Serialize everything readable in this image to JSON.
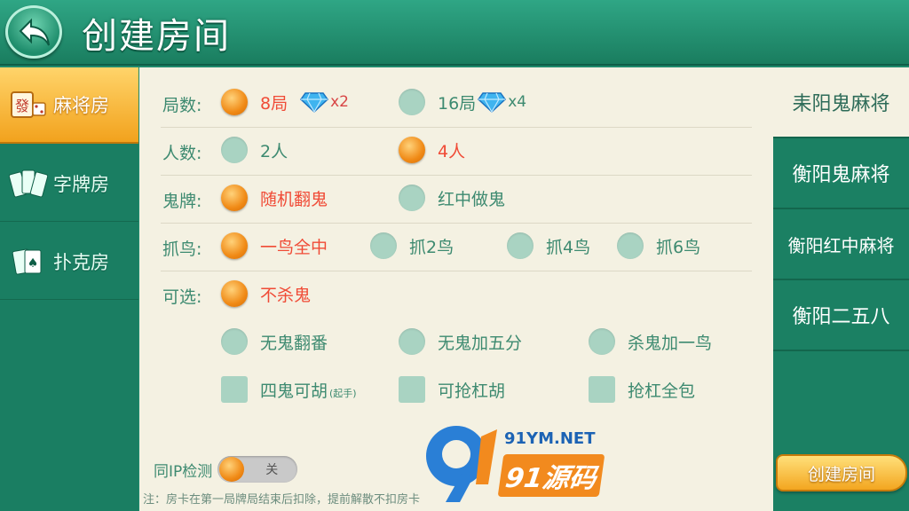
{
  "header": {
    "title": "创建房间",
    "back_icon": "back-arrow-icon"
  },
  "sidebar": {
    "items": [
      {
        "label": "麻将房",
        "icon": "mahjong-tile-icon",
        "active": true
      },
      {
        "label": "字牌房",
        "icon": "word-cards-icon",
        "active": false
      },
      {
        "label": "扑克房",
        "icon": "poker-cards-icon",
        "active": false
      }
    ]
  },
  "options": {
    "rounds": {
      "label": "局数:",
      "choices": [
        {
          "text": "8局",
          "selected": true,
          "gem_multiplier": "x2"
        },
        {
          "text": "16局",
          "selected": false,
          "gem_multiplier": "x4"
        }
      ]
    },
    "players": {
      "label": "人数:",
      "choices": [
        {
          "text": "2人",
          "selected": false
        },
        {
          "text": "4人",
          "selected": true
        }
      ]
    },
    "ghost": {
      "label": "鬼牌:",
      "choices": [
        {
          "text": "随机翻鬼",
          "selected": true
        },
        {
          "text": "红中做鬼",
          "selected": false
        }
      ]
    },
    "birds": {
      "label": "抓鸟:",
      "choices": [
        {
          "text": "一鸟全中",
          "selected": true
        },
        {
          "text": "抓2鸟",
          "selected": false
        },
        {
          "text": "抓4鸟",
          "selected": false
        },
        {
          "text": "抓6鸟",
          "selected": false
        }
      ]
    },
    "optional": {
      "label": "可选:",
      "choices": [
        {
          "text": "不杀鬼",
          "selected": true
        },
        {
          "text": "无鬼翻番",
          "selected": false
        },
        {
          "text": "无鬼加五分",
          "selected": false
        },
        {
          "text": "杀鬼加一鸟",
          "selected": false
        }
      ],
      "checkboxes": [
        {
          "text": "四鬼可胡",
          "suffix": "(起手)",
          "checked": false
        },
        {
          "text": "可抢杠胡",
          "checked": false
        },
        {
          "text": "抢杠全包",
          "checked": false
        }
      ]
    }
  },
  "ip_check": {
    "label": "同IP检测",
    "state": "关"
  },
  "note": "注：房卡在第一局牌局结束后扣除，提前解散不扣房卡",
  "watermark": {
    "url": "91YM.NET",
    "brand": "91源码"
  },
  "modes": [
    {
      "label": "耒阳鬼麻将",
      "active": true
    },
    {
      "label": "衡阳鬼麻将",
      "active": false
    },
    {
      "label": "衡阳红中麻将",
      "active": false
    },
    {
      "label": "衡阳二五八",
      "active": false
    }
  ],
  "create_button": "创建房间",
  "colors": {
    "accent_orange": "#f08a16",
    "selected_text": "#f04b36",
    "option_text": "#3d8a70",
    "panel_bg": "#f4f1e2"
  }
}
